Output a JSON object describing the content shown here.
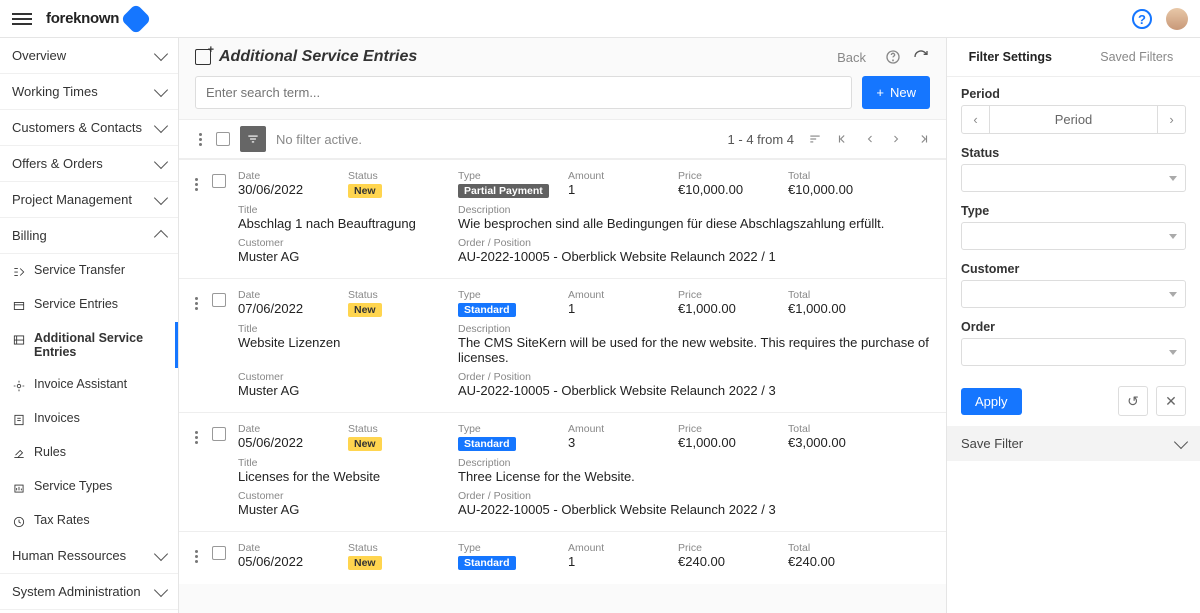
{
  "brand": "foreknown",
  "header": {
    "back": "Back"
  },
  "sidebar": {
    "top": [
      {
        "label": "Overview",
        "expanded": false
      },
      {
        "label": "Working Times",
        "expanded": false
      },
      {
        "label": "Customers & Contacts",
        "expanded": false
      },
      {
        "label": "Offers & Orders",
        "expanded": false
      },
      {
        "label": "Project Management",
        "expanded": false
      },
      {
        "label": "Billing",
        "expanded": true
      }
    ],
    "billing_sub": [
      {
        "label": "Service Transfer"
      },
      {
        "label": "Service Entries"
      },
      {
        "label": "Additional Service Entries",
        "active": true
      },
      {
        "label": "Invoice Assistant"
      },
      {
        "label": "Invoices"
      },
      {
        "label": "Rules"
      },
      {
        "label": "Service Types"
      },
      {
        "label": "Tax Rates"
      }
    ],
    "bottom": [
      {
        "label": "Human Ressources",
        "expanded": false
      },
      {
        "label": "System Administration",
        "expanded": false
      }
    ]
  },
  "page": {
    "title": "Additional Service Entries",
    "search_placeholder": "Enter search term...",
    "new_btn": "New",
    "no_filter": "No filter active.",
    "range": "1 - 4 from 4"
  },
  "labels": {
    "date": "Date",
    "status": "Status",
    "type": "Type",
    "amount": "Amount",
    "price": "Price",
    "total": "Total",
    "title": "Title",
    "description": "Description",
    "customer": "Customer",
    "order": "Order / Position"
  },
  "entries": [
    {
      "date": "30/06/2022",
      "status": "New",
      "type": "Partial Payment",
      "type_class": "partial",
      "amount": "1",
      "price": "€10,000.00",
      "total": "€10,000.00",
      "title": "Abschlag 1 nach Beauftragung",
      "description": "Wie besprochen sind alle Bedingungen für diese Abschlagszahlung erfüllt.",
      "customer": "Muster AG",
      "order": "AU-2022-10005 - Oberblick Website Relaunch 2022 / 1"
    },
    {
      "date": "07/06/2022",
      "status": "New",
      "type": "Standard",
      "type_class": "standard",
      "amount": "1",
      "price": "€1,000.00",
      "total": "€1,000.00",
      "title": "Website Lizenzen",
      "description": "The CMS SiteKern will be used for the new website. This requires the purchase of licenses.",
      "customer": "Muster AG",
      "order": "AU-2022-10005 - Oberblick Website Relaunch 2022 / 3"
    },
    {
      "date": "05/06/2022",
      "status": "New",
      "type": "Standard",
      "type_class": "standard",
      "amount": "3",
      "price": "€1,000.00",
      "total": "€3,000.00",
      "title": "Licenses for the Website",
      "description": "Three License for the Website.",
      "customer": "Muster AG",
      "order": "AU-2022-10005 - Oberblick Website Relaunch 2022 / 3"
    },
    {
      "date": "05/06/2022",
      "status": "New",
      "type": "Standard",
      "type_class": "standard",
      "amount": "1",
      "price": "€240.00",
      "total": "€240.00",
      "title": "",
      "description": "",
      "customer": "",
      "order": ""
    }
  ],
  "filters": {
    "tab_settings": "Filter Settings",
    "tab_saved": "Saved Filters",
    "period": "Period",
    "period_value": "Period",
    "status": "Status",
    "type": "Type",
    "customer": "Customer",
    "order": "Order",
    "apply": "Apply",
    "save_filter": "Save Filter"
  }
}
